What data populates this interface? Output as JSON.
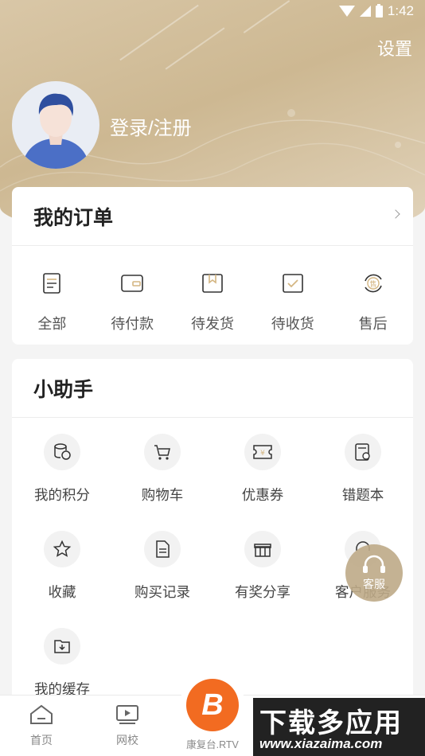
{
  "status_bar": {
    "time": "1:42"
  },
  "header": {
    "settings_label": "设置",
    "login_label": "登录/注册"
  },
  "orders": {
    "title": "我的订单",
    "items": [
      {
        "label": "全部",
        "icon": "document-icon"
      },
      {
        "label": "待付款",
        "icon": "wallet-icon"
      },
      {
        "label": "待发货",
        "icon": "package-icon"
      },
      {
        "label": "待收货",
        "icon": "checkbox-icon"
      },
      {
        "label": "售后",
        "icon": "after-sales-icon"
      }
    ]
  },
  "helper": {
    "title": "小助手",
    "items": [
      {
        "label": "我的积分",
        "icon": "points-icon"
      },
      {
        "label": "购物车",
        "icon": "cart-icon"
      },
      {
        "label": "优惠券",
        "icon": "coupon-icon"
      },
      {
        "label": "错题本",
        "icon": "notebook-icon"
      },
      {
        "label": "收藏",
        "icon": "star-icon"
      },
      {
        "label": "购买记录",
        "icon": "receipt-icon"
      },
      {
        "label": "有奖分享",
        "icon": "gift-icon"
      },
      {
        "label": "客户服务",
        "icon": "headset-icon"
      },
      {
        "label": "我的缓存",
        "icon": "download-folder-icon"
      }
    ]
  },
  "floating_service": {
    "label": "客服"
  },
  "tabbar": {
    "home": "首页",
    "school": "网校",
    "center": "康复台.RTV"
  },
  "watermark": {
    "title": "下载多应用",
    "url": "www.xiazaima.com"
  },
  "colors": {
    "accent": "#cdb892",
    "brand_orange": "#f26b21"
  }
}
